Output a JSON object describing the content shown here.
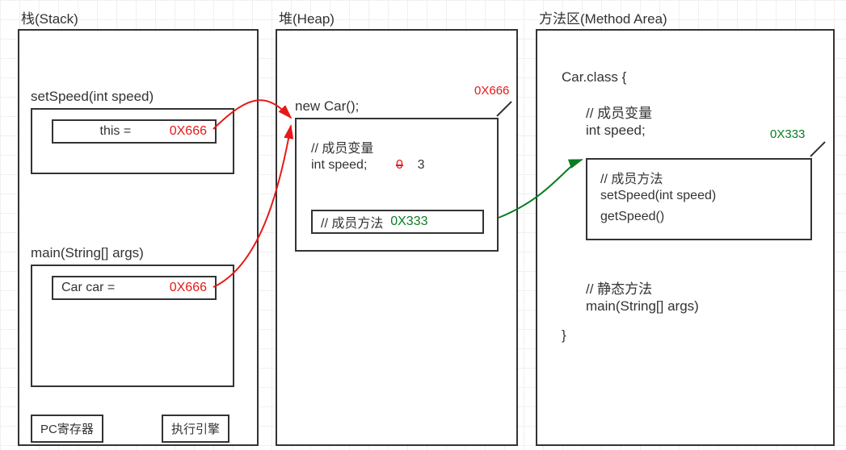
{
  "stack": {
    "title": "栈(Stack)",
    "frame1": {
      "title": "setSpeed(int speed)",
      "var_label": "this =",
      "var_value": "0X666"
    },
    "frame2": {
      "title": "main(String[] args)",
      "var_label": "Car car =",
      "var_value": "0X666"
    },
    "pc_label": "PC寄存器",
    "engine_label": "执行引擎"
  },
  "heap": {
    "title": "堆(Heap)",
    "object": {
      "header": "new Car();",
      "addr": "0X666",
      "field_comment": "// 成员变量",
      "field_decl": "int speed;",
      "field_old": "0",
      "field_new": "3",
      "method_comment": "// 成员方法",
      "method_ptr": "0X333"
    }
  },
  "methodArea": {
    "title": "方法区(Method Area)",
    "class_open": "Car.class {",
    "field_comment": "// 成员变量",
    "field_decl": "int speed;",
    "method_addr": "0X333",
    "method_comment": "// 成员方法",
    "method1": "setSpeed(int speed)",
    "method2": "getSpeed()",
    "static_comment": "// 静态方法",
    "static_method": "main(String[] args)",
    "class_close": "}"
  }
}
